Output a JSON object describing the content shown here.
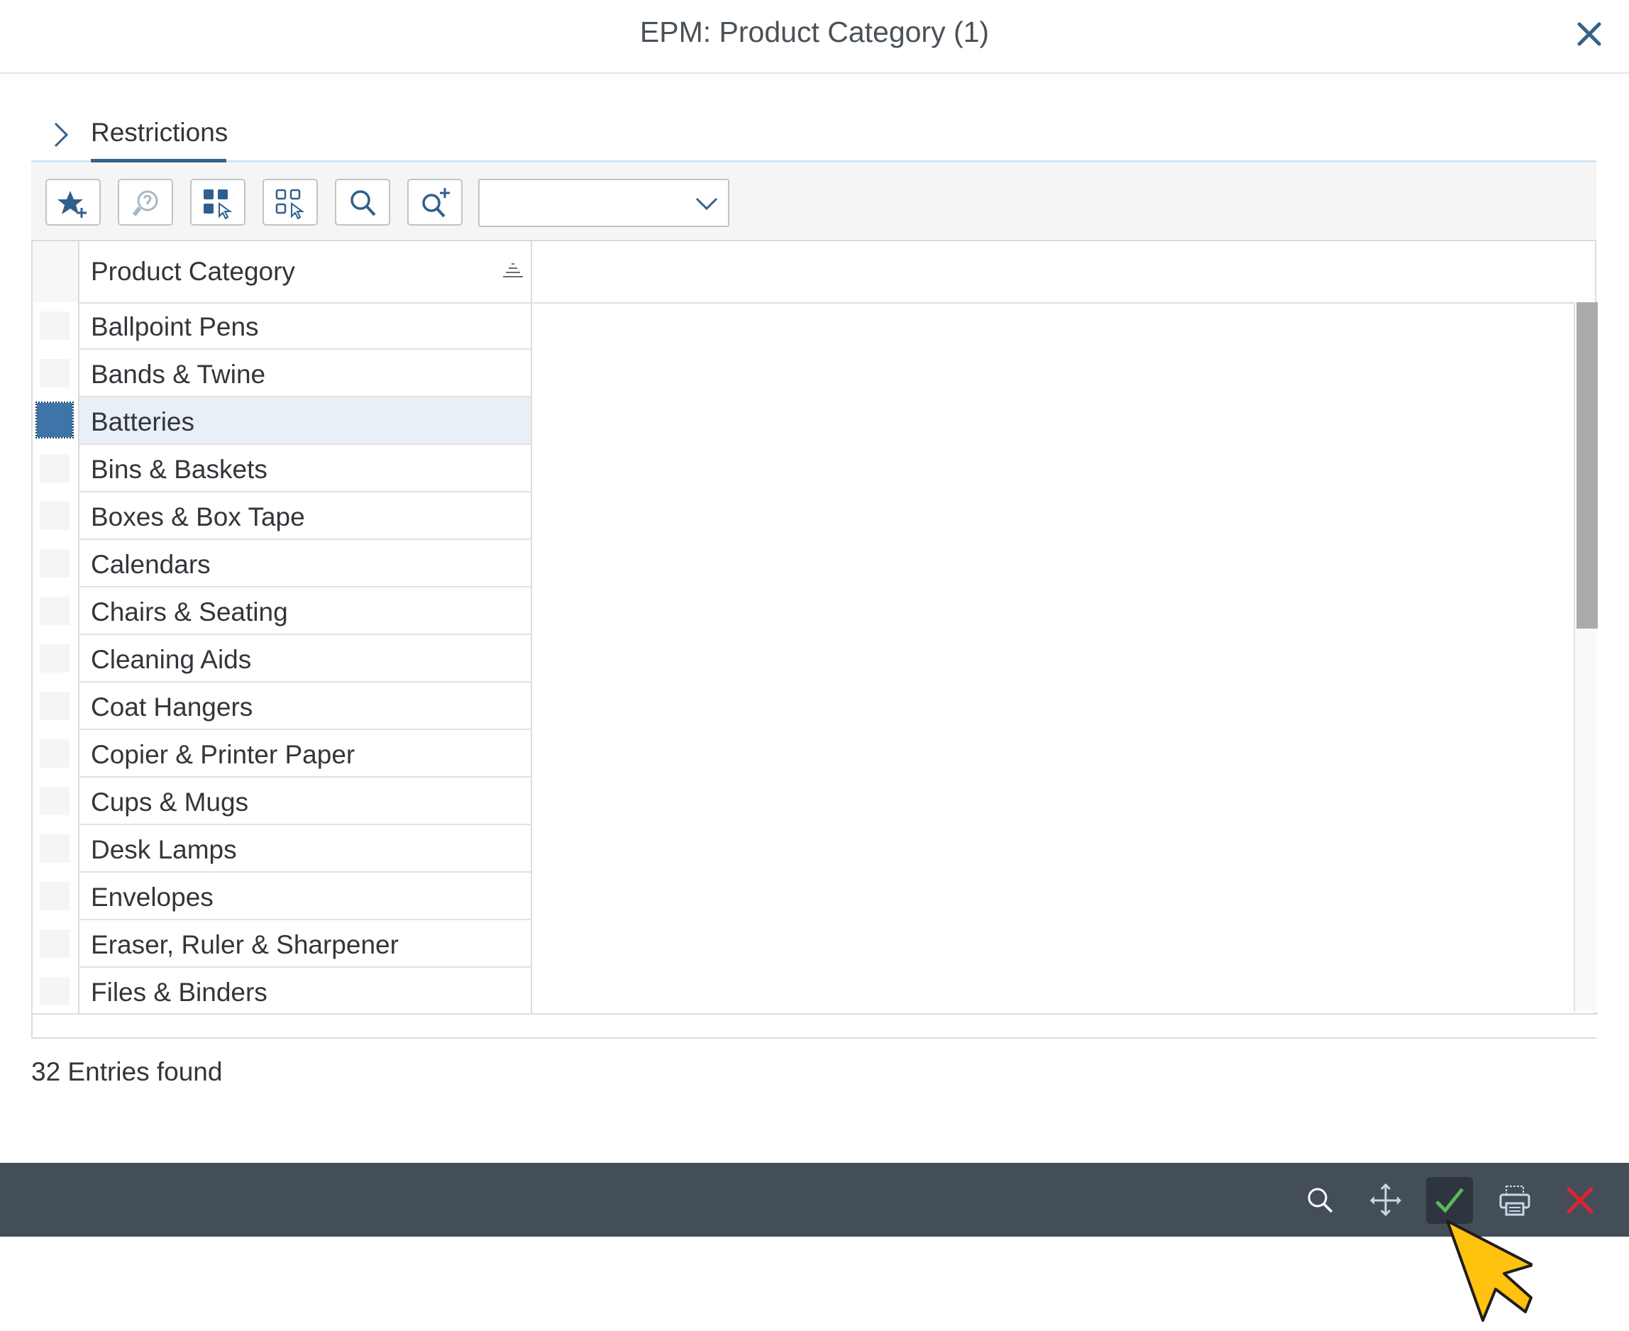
{
  "dialog": {
    "title": "EPM: Product Category (1)",
    "close_icon": "close-icon"
  },
  "restrictions": {
    "label": "Restrictions",
    "expanded": false
  },
  "toolbar": {
    "buttons": [
      {
        "name": "add-favorite-button",
        "icon": "star-plus-icon"
      },
      {
        "name": "help-button",
        "icon": "help-icon",
        "disabled": true
      },
      {
        "name": "select-all-button",
        "icon": "select-all-icon"
      },
      {
        "name": "deselect-all-button",
        "icon": "deselect-all-icon"
      },
      {
        "name": "find-button",
        "icon": "search-icon"
      },
      {
        "name": "find-next-button",
        "icon": "search-plus-icon"
      }
    ],
    "dropdown_value": ""
  },
  "table": {
    "column_header": "Product Category",
    "rows": [
      {
        "label": "Ballpoint Pens",
        "selected": false
      },
      {
        "label": "Bands & Twine",
        "selected": false
      },
      {
        "label": "Batteries",
        "selected": true
      },
      {
        "label": "Bins & Baskets",
        "selected": false
      },
      {
        "label": "Boxes & Box Tape",
        "selected": false
      },
      {
        "label": "Calendars",
        "selected": false
      },
      {
        "label": "Chairs & Seating",
        "selected": false
      },
      {
        "label": "Cleaning Aids",
        "selected": false
      },
      {
        "label": "Coat Hangers",
        "selected": false
      },
      {
        "label": "Copier & Printer Paper",
        "selected": false
      },
      {
        "label": "Cups & Mugs",
        "selected": false
      },
      {
        "label": "Desk Lamps",
        "selected": false
      },
      {
        "label": "Envelopes",
        "selected": false
      },
      {
        "label": "Eraser, Ruler & Sharpener",
        "selected": false
      },
      {
        "label": "Files & Binders",
        "selected": false
      }
    ]
  },
  "status": {
    "entries_text": "32 Entries found"
  },
  "footer": {
    "buttons": [
      {
        "name": "footer-search-button",
        "icon": "search-icon"
      },
      {
        "name": "footer-navigate-button",
        "icon": "move-icon"
      },
      {
        "name": "footer-ok-button",
        "icon": "checkmark-icon"
      },
      {
        "name": "footer-print-button",
        "icon": "print-icon"
      },
      {
        "name": "footer-cancel-button",
        "icon": "cancel-icon"
      }
    ]
  },
  "colors": {
    "accent": "#346187",
    "footer_bg": "#444e59",
    "selected_row": "#e8eff7",
    "ok_green": "#5cb85c",
    "cancel_red": "#e0242b",
    "cursor": "#ffc20e"
  }
}
